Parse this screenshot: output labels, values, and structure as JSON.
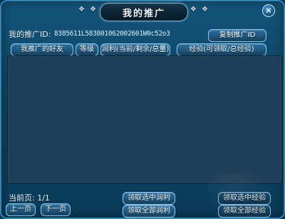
{
  "window": {
    "title": "我的推广",
    "ornament_left": "❖ ❖",
    "ornament_right": "❖ ❖",
    "close_icon": "close-icon"
  },
  "promo": {
    "id_label": "我的推广ID:",
    "id_value": "8385611L583801062002601W0c52o3",
    "copy_button": "复制推广ID"
  },
  "table": {
    "columns": [
      "我推广的好友",
      "等级",
      "润利(当前/剩余/总量)",
      "经验(可领取/总经验)"
    ],
    "rows": []
  },
  "pagination": {
    "current_page_label": "当前页:",
    "current_page_value": "1/1",
    "prev_button": "上一页",
    "next_button": "下一页"
  },
  "actions": {
    "claim_selected_profit": "领取选中润利",
    "claim_all_profit": "领取全部润利",
    "claim_selected_exp": "领取选中经验",
    "claim_all_exp": "领取全部经验"
  }
}
